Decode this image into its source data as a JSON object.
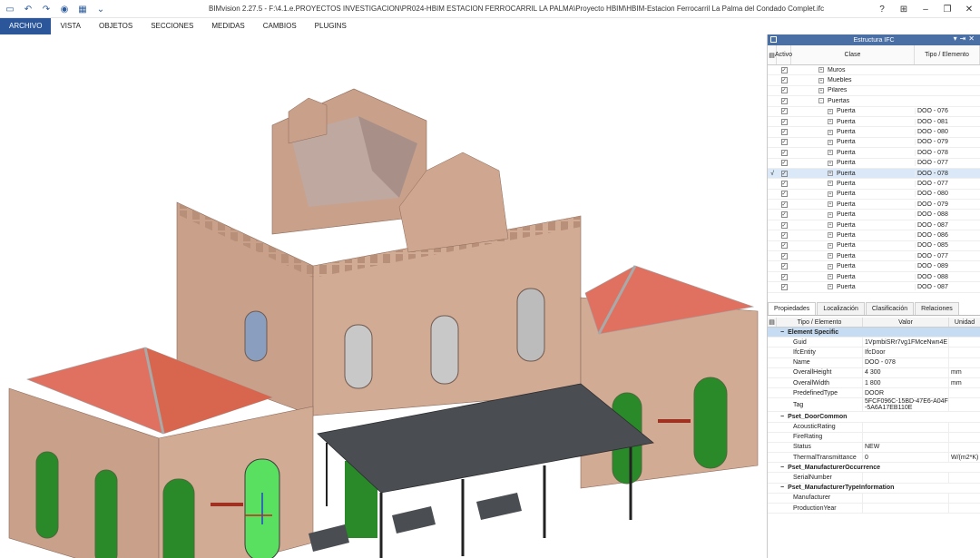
{
  "window": {
    "title": "BIMvision 2.27.5 - F:\\4.1.e.PROYECTOS INVESTIGACION\\PR024-HBIM ESTACION FERROCARRIL LA PALMA\\Proyecto HBIM\\HBIM-Estacion Ferrocarril La Palma del Condado Complet.ifc",
    "help": "?",
    "restore": "⊞",
    "minimize": "–",
    "maximize": "❐",
    "close": "✕"
  },
  "quick_access": {
    "open_icon": "folder-icon",
    "undo_icon": "undo-icon",
    "redo_icon": "redo-icon",
    "extra": "⌄"
  },
  "menu": [
    "ARCHIVO",
    "VISTA",
    "OBJETOS",
    "SECCIONES",
    "MEDIDAS",
    "CAMBIOS",
    "PLUGINS"
  ],
  "structure_panel": {
    "title": "Estructura IFC",
    "columns": {
      "active": "Activo",
      "class": "Clase",
      "type": "Tipo / Elemento"
    },
    "rows": [
      {
        "label": "Muros",
        "type": "",
        "level": 1,
        "expander": "+"
      },
      {
        "label": "Muebles",
        "type": "",
        "level": 1,
        "expander": "+"
      },
      {
        "label": "Pilares",
        "type": "",
        "level": 1,
        "expander": "+"
      },
      {
        "label": "Puertas",
        "type": "",
        "level": 1,
        "expander": "-"
      },
      {
        "label": "Puerta",
        "type": "DOO - 076",
        "level": 2,
        "expander": "+"
      },
      {
        "label": "Puerta",
        "type": "DOO - 081",
        "level": 2,
        "expander": "+"
      },
      {
        "label": "Puerta",
        "type": "DOO - 080",
        "level": 2,
        "expander": "+"
      },
      {
        "label": "Puerta",
        "type": "DOO - 079",
        "level": 2,
        "expander": "+"
      },
      {
        "label": "Puerta",
        "type": "DOO - 078",
        "level": 2,
        "expander": "+"
      },
      {
        "label": "Puerta",
        "type": "DOO - 077",
        "level": 2,
        "expander": "+"
      },
      {
        "label": "Puerta",
        "type": "DOO - 078",
        "level": 2,
        "expander": "+",
        "selected": true,
        "mark": "√"
      },
      {
        "label": "Puerta",
        "type": "DOO - 077",
        "level": 2,
        "expander": "+"
      },
      {
        "label": "Puerta",
        "type": "DOO - 080",
        "level": 2,
        "expander": "+"
      },
      {
        "label": "Puerta",
        "type": "DOO - 079",
        "level": 2,
        "expander": "+"
      },
      {
        "label": "Puerta",
        "type": "DOO - 088",
        "level": 2,
        "expander": "+"
      },
      {
        "label": "Puerta",
        "type": "DOO - 087",
        "level": 2,
        "expander": "+"
      },
      {
        "label": "Puerta",
        "type": "DOO - 086",
        "level": 2,
        "expander": "+"
      },
      {
        "label": "Puerta",
        "type": "DOO - 085",
        "level": 2,
        "expander": "+"
      },
      {
        "label": "Puerta",
        "type": "DOO - 077",
        "level": 2,
        "expander": "+"
      },
      {
        "label": "Puerta",
        "type": "DOO - 089",
        "level": 2,
        "expander": "+"
      },
      {
        "label": "Puerta",
        "type": "DOO - 088",
        "level": 2,
        "expander": "+"
      },
      {
        "label": "Puerta",
        "type": "DOO - 087",
        "level": 2,
        "expander": "+"
      }
    ]
  },
  "tabs": [
    "Propiedades",
    "Localización",
    "Clasificación",
    "Relaciones"
  ],
  "properties": {
    "columns": {
      "key": "Tipo / Elemento",
      "value": "Valor",
      "unit": "Unidad"
    },
    "rows": [
      {
        "group": true,
        "key": "Element Specific",
        "highlight": true
      },
      {
        "key": "Guid",
        "value": "1VpmbiSRr7vg1FMceNwn4E",
        "unit": ""
      },
      {
        "key": "IfcEntity",
        "value": "IfcDoor",
        "unit": ""
      },
      {
        "key": "Name",
        "value": "DOO - 078",
        "unit": ""
      },
      {
        "key": "OverallHeight",
        "value": "4 300",
        "unit": "mm"
      },
      {
        "key": "OverallWidth",
        "value": "1 800",
        "unit": "mm"
      },
      {
        "key": "PredefinedType",
        "value": "DOOR",
        "unit": ""
      },
      {
        "key": "Tag",
        "value": "5FCF096C-15BD-47E6-A04F-5A6A17EB110E",
        "unit": ""
      },
      {
        "group": true,
        "key": "Pset_DoorCommon"
      },
      {
        "key": "AcousticRating",
        "value": "",
        "unit": ""
      },
      {
        "key": "FireRating",
        "value": "",
        "unit": ""
      },
      {
        "key": "Status",
        "value": "NEW",
        "unit": ""
      },
      {
        "key": "ThermalTransmittance",
        "value": "0",
        "unit": "W/(m2*K)"
      },
      {
        "group": true,
        "key": "Pset_ManufacturerOccurrence"
      },
      {
        "key": "SerialNumber",
        "value": "",
        "unit": ""
      },
      {
        "group": true,
        "key": "Pset_ManufacturerTypeInformation"
      },
      {
        "key": "Manufacturer",
        "value": "",
        "unit": ""
      },
      {
        "key": "ProductionYear",
        "value": "",
        "unit": ""
      }
    ]
  },
  "colors": {
    "accent": "#2b579a",
    "panel_header": "#4a6fa5",
    "brick": "#c9a08a",
    "roof": "#e07060",
    "door": "#2a8a2a",
    "door_selected": "#59e060",
    "canopy": "#4a4d52"
  }
}
